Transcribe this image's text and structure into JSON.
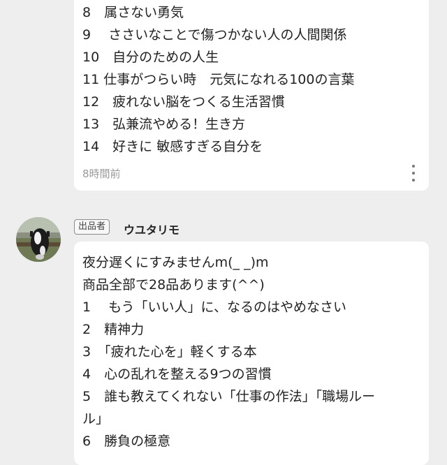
{
  "previous_comment": {
    "lines": [
      "8　属さない勇気",
      "9　 ささいなことで傷つかない人の人間関係",
      "10　自分のための人生",
      "11 仕事がつらい時　元気になれる100の言葉",
      "12　疲れない脳をつくる生活習慣",
      "13　弘兼流やめる！生き方",
      "14　好きに 敏感すぎる自分を"
    ],
    "timestamp": "8時間前",
    "more_icon": "more-vertical-icon"
  },
  "comment": {
    "badge": "出品者",
    "username": "ウユタリモ",
    "avatar_icon": "cow-photo-avatar",
    "lines": [
      "夜分遅くにすみませんm(_ _)m",
      "商品全部で28品あります(^^)",
      "1　 もう「いい人」に、なるのはやめなさい",
      "2　精神力",
      "3　「疲れた心を」軽くする本",
      "4　心の乱れを整える9つの習慣",
      "5　誰も教えてくれない「仕事の作法」「職場ルー",
      "ル」",
      "6　勝負の極意"
    ]
  }
}
